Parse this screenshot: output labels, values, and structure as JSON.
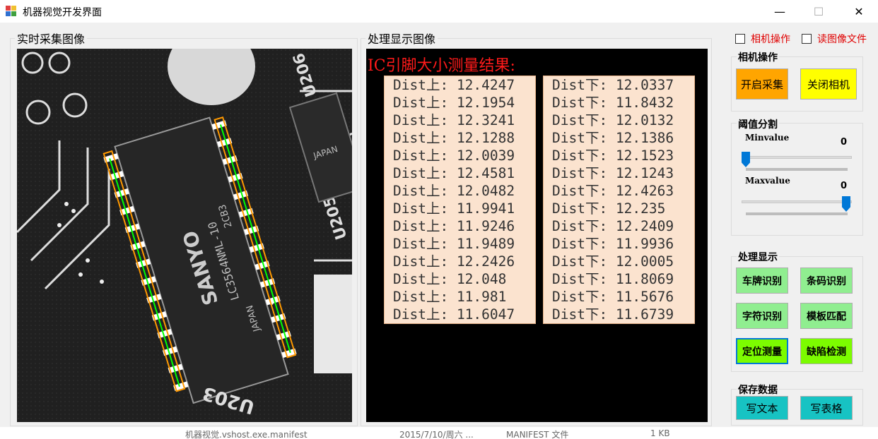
{
  "window": {
    "title": "机器视觉开发界面",
    "min_glyph": "—",
    "max_glyph": "☐",
    "close_glyph": "✕"
  },
  "groups": {
    "camera": "实时采集图像",
    "processed": "处理显示图像"
  },
  "checkboxes": {
    "camera_op": "相机操作",
    "read_image": "读图像文件"
  },
  "camera_ops": {
    "title": "相机操作",
    "start": "开启采集",
    "close": "关闭相机"
  },
  "threshold": {
    "title": "阈值分割",
    "min_label": "Minvalue",
    "min_value": "0",
    "min_level": 0,
    "max_label": "Maxvalue",
    "max_value": "0",
    "max_level": 1
  },
  "process": {
    "title": "处理显示",
    "plate": "车牌识别",
    "barcode": "条码识别",
    "char": "字符识别",
    "template": "模板匹配",
    "locate": "定位测量",
    "defect": "缺陷检测"
  },
  "save": {
    "title": "保存数据",
    "text": "写文本",
    "table": "写表格"
  },
  "result": {
    "title": "IC引脚大小测量结果:",
    "upper": [
      "Dist上: 12.4247",
      "Dist上: 12.1954",
      "Dist上: 12.3241",
      "Dist上: 12.1288",
      "Dist上: 12.0039",
      "Dist上: 12.4581",
      "Dist上: 12.0482",
      "Dist上: 11.9941",
      "Dist上: 11.9246",
      "Dist上: 11.9489",
      "Dist上: 12.2426",
      "Dist上: 12.048",
      "Dist上: 11.981",
      "Dist上: 11.6047"
    ],
    "lower": [
      "Dist下: 12.0337",
      "Dist下: 11.8432",
      "Dist下: 12.0132",
      "Dist下: 12.1386",
      "Dist下: 12.1523",
      "Dist下: 12.1243",
      "Dist下: 12.4263",
      "Dist下: 12.235",
      "Dist下: 12.2409",
      "Dist下: 11.9936",
      "Dist下: 12.0005",
      "Dist下: 11.8069",
      "Dist下: 11.5676",
      "Dist下: 11.6739"
    ]
  },
  "image": {
    "chip_text1": "SANYO",
    "chip_text2": "LC3564NML-10",
    "chip_text3": "2CB3",
    "chip_text4": "JAPAN",
    "label_u206": "U206",
    "label_u205": "U205",
    "label_u203": "U203",
    "label_japan2": "JAPAN"
  },
  "background_strip": {
    "file": "机器视觉.vshost.exe.manifest",
    "date": "2015/7/10/周六 ...",
    "type": "MANIFEST 文件",
    "size": "1 KB"
  }
}
